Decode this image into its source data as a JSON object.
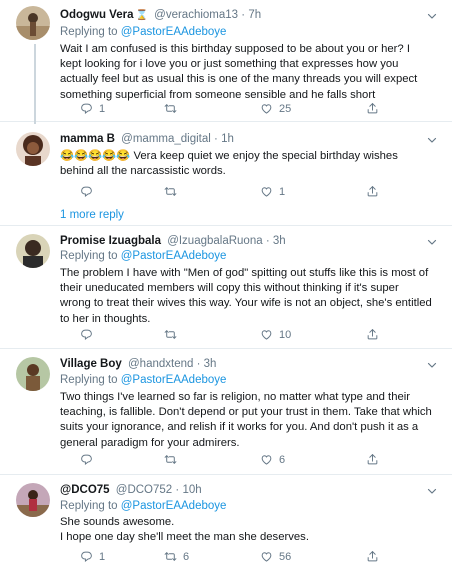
{
  "tweets": [
    {
      "name": "Odogwu Vera",
      "badge": "⌛",
      "handle": "@verachioma13",
      "dot": "·",
      "time": "7h",
      "reply_prefix": "Replying to",
      "reply_mention": "@PastorEAAdeboye",
      "text": "Wait I am confused is this birthday supposed to be about you or her? I kept looking for i love you or just something that expresses how you actually feel but as usual this is one of the many threads you will expect something superficial from someone sensible and he falls short",
      "replies": "1",
      "retweets": "",
      "likes": "25"
    },
    {
      "name": "mamma B",
      "handle": "@mamma_digital",
      "dot": "·",
      "time": "1h",
      "emojis": "😂😂😂😂😂",
      "text": "Vera keep quiet we enjoy the special birthday wishes behind all the narcassistic words.",
      "replies": "",
      "retweets": "",
      "likes": "1",
      "more_replies": "1 more reply"
    },
    {
      "name": "Promise Izuagbala",
      "handle": "@IzuagbalaRuona",
      "dot": "·",
      "time": "3h",
      "reply_prefix": "Replying to",
      "reply_mention": "@PastorEAAdeboye",
      "text": "The problem I have with \"Men of god\" spitting out stuffs like this is most of their uneducated members will copy this without thinking if it's super wrong to treat their wives this way. Your wife is not an object, she's entitled to her in thoughts.",
      "replies": "",
      "retweets": "",
      "likes": "10"
    },
    {
      "name": "Village Boy",
      "handle": "@handxtend",
      "dot": "·",
      "time": "3h",
      "reply_prefix": "Replying to",
      "reply_mention": "@PastorEAAdeboye",
      "text": "Two things I've learned so far is religion,  no matter what type and their teaching, is fallible.  Don't depend or put your trust in them. Take that which suits your ignorance, and relish if it works for you.  And don't push it as a general paradigm for your admirers.",
      "replies": "",
      "retweets": "",
      "likes": "6"
    },
    {
      "name": "@DCO75",
      "handle": "@DCO752",
      "dot": "·",
      "time": "10h",
      "reply_prefix": "Replying to",
      "reply_mention": "@PastorEAAdeboye",
      "text_line1": "She sounds awesome.",
      "text_line2": "I hope one day she'll meet the man she deserves.",
      "replies": "1",
      "retweets": "6",
      "likes": "56"
    }
  ],
  "colors": {
    "link": "#1b95e0",
    "muted": "#657786",
    "border": "#e6ecf0"
  },
  "icons": [
    "avatar",
    "chevron-down-icon",
    "reply-icon",
    "retweet-icon",
    "like-icon",
    "share-icon"
  ]
}
